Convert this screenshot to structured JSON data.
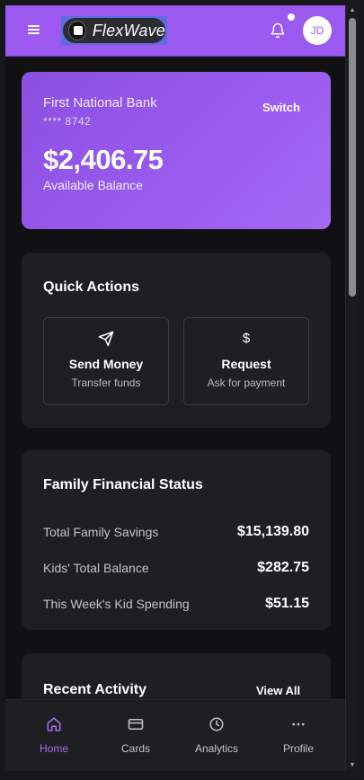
{
  "header": {
    "app_name": "FlexWave",
    "avatar_initials": "JD",
    "accent_color": "#9b59f0"
  },
  "balance": {
    "bank_name": "First National Bank",
    "account_mask": "**** 8742",
    "switch_label": "Switch",
    "amount": "$2,406.75",
    "caption": "Available Balance"
  },
  "quick_actions": {
    "title": "Quick Actions",
    "items": [
      {
        "icon": "send-icon",
        "label": "Send Money",
        "sub": "Transfer funds"
      },
      {
        "icon": "dollar-icon",
        "glyph": "$",
        "label": "Request",
        "sub": "Ask for payment"
      }
    ]
  },
  "family": {
    "title": "Family Financial Status",
    "rows": [
      {
        "label": "Total Family Savings",
        "value": "$15,139.80"
      },
      {
        "label": "Kids' Total Balance",
        "value": "$282.75"
      },
      {
        "label": "This Week's Kid Spending",
        "value": "$51.15"
      }
    ]
  },
  "recent": {
    "title": "Recent Activity",
    "view_all": "View All"
  },
  "nav": {
    "items": [
      {
        "icon": "home-icon",
        "label": "Home",
        "active": true
      },
      {
        "icon": "card-icon",
        "label": "Cards"
      },
      {
        "icon": "clock-icon",
        "label": "Analytics"
      },
      {
        "icon": "more-icon",
        "label": "Profile"
      }
    ]
  }
}
